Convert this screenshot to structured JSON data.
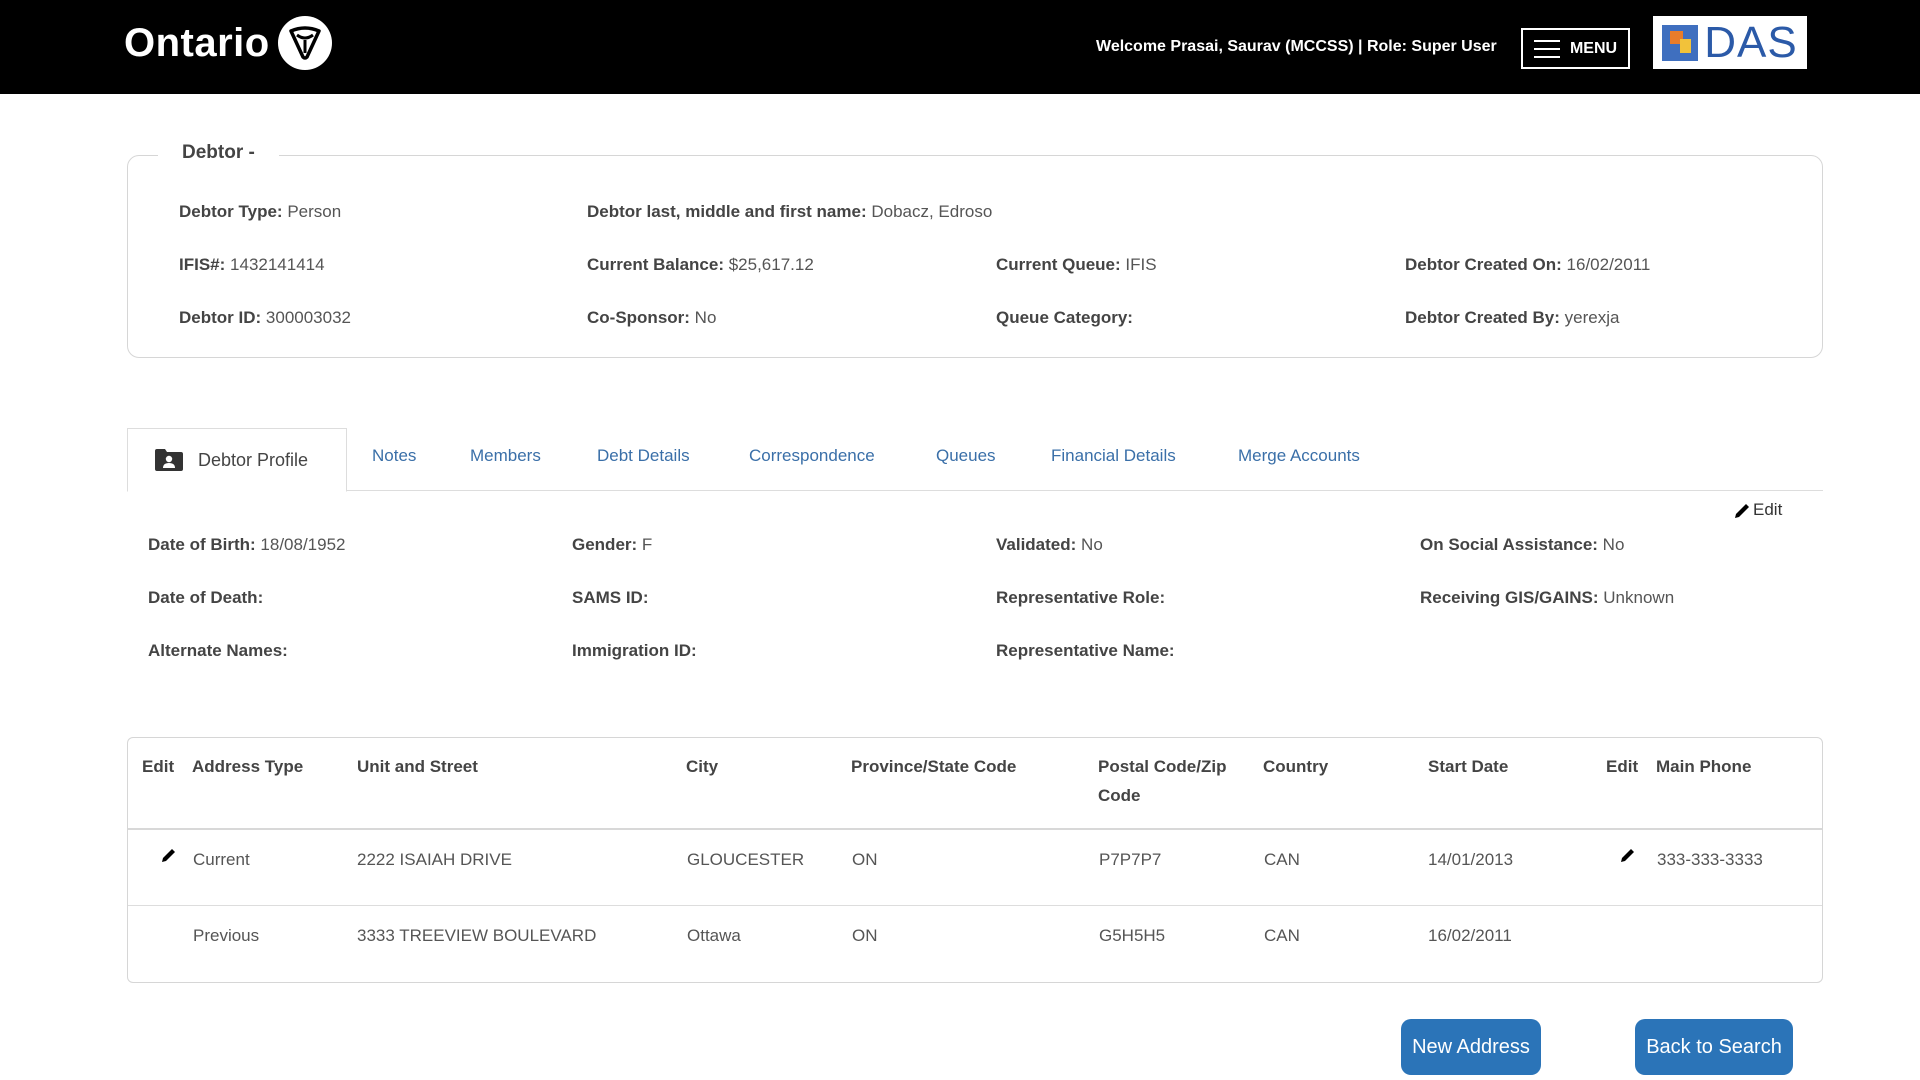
{
  "header": {
    "brand": "Ontario",
    "welcome": "Welcome Prasai, Saurav (MCCSS) | Role: Super User",
    "menu_label": "MENU",
    "app_logo_text": "DAS"
  },
  "debtor": {
    "legend": "Debtor -",
    "fields": [
      {
        "label": "Debtor Type:",
        "value": "Person"
      },
      {
        "label": "Debtor last, middle and first name:",
        "value": "Dobacz, Edroso"
      },
      {
        "label": "IFIS#:",
        "value": "1432141414"
      },
      {
        "label": "Current Balance:",
        "value": "$25,617.12"
      },
      {
        "label": "Current Queue:",
        "value": "IFIS"
      },
      {
        "label": "Debtor Created On:",
        "value": "16/02/2011"
      },
      {
        "label": "Debtor ID:",
        "value": "300003032"
      },
      {
        "label": "Co-Sponsor:",
        "value": "No"
      },
      {
        "label": "Queue Category:",
        "value": ""
      },
      {
        "label": "Debtor Created By:",
        "value": "yerexja"
      }
    ]
  },
  "tabs": [
    {
      "label": "Debtor Profile",
      "active": true
    },
    {
      "label": "Notes"
    },
    {
      "label": "Members"
    },
    {
      "label": "Debt Details"
    },
    {
      "label": "Correspondence"
    },
    {
      "label": "Queues"
    },
    {
      "label": "Financial Details"
    },
    {
      "label": "Merge Accounts"
    }
  ],
  "profile": {
    "edit_label": "Edit",
    "fields": [
      {
        "label": "Date of Birth:",
        "value": "18/08/1952"
      },
      {
        "label": "Gender:",
        "value": "F"
      },
      {
        "label": "Validated:",
        "value": "No"
      },
      {
        "label": "On Social Assistance:",
        "value": "No"
      },
      {
        "label": "Date of Death:",
        "value": ""
      },
      {
        "label": "SAMS ID:",
        "value": ""
      },
      {
        "label": "Representative Role:",
        "value": ""
      },
      {
        "label": "Receiving GIS/GAINS:",
        "value": "Unknown"
      },
      {
        "label": "Alternate Names:",
        "value": ""
      },
      {
        "label": "Immigration ID:",
        "value": ""
      },
      {
        "label": "Representative Name:",
        "value": ""
      }
    ]
  },
  "address_table": {
    "headers": [
      "Edit",
      "Address Type",
      "Unit and Street",
      "City",
      "Province/State Code",
      "Postal Code/Zip Code",
      "Country",
      "Start Date",
      "Edit",
      "Main Phone"
    ],
    "rows": [
      {
        "type": "Current",
        "street": "2222 ISAIAH DRIVE",
        "city": "GLOUCESTER",
        "province": "ON",
        "postal": "P7P7P7",
        "country": "CAN",
        "start": "14/01/2013",
        "phone": "333-333-3333"
      },
      {
        "type": "Previous",
        "street": "3333 TREEVIEW BOULEVARD",
        "city": "Ottawa",
        "province": "ON",
        "postal": "G5H5H5",
        "country": "CAN",
        "start": "16/02/2011",
        "phone": ""
      }
    ]
  },
  "buttons": {
    "new_address": "New Address",
    "back_to_search": "Back to Search"
  },
  "colors": {
    "header_bg": "#000000",
    "tab_link": "#3a6fa8",
    "button_bg": "#2b74b8"
  }
}
